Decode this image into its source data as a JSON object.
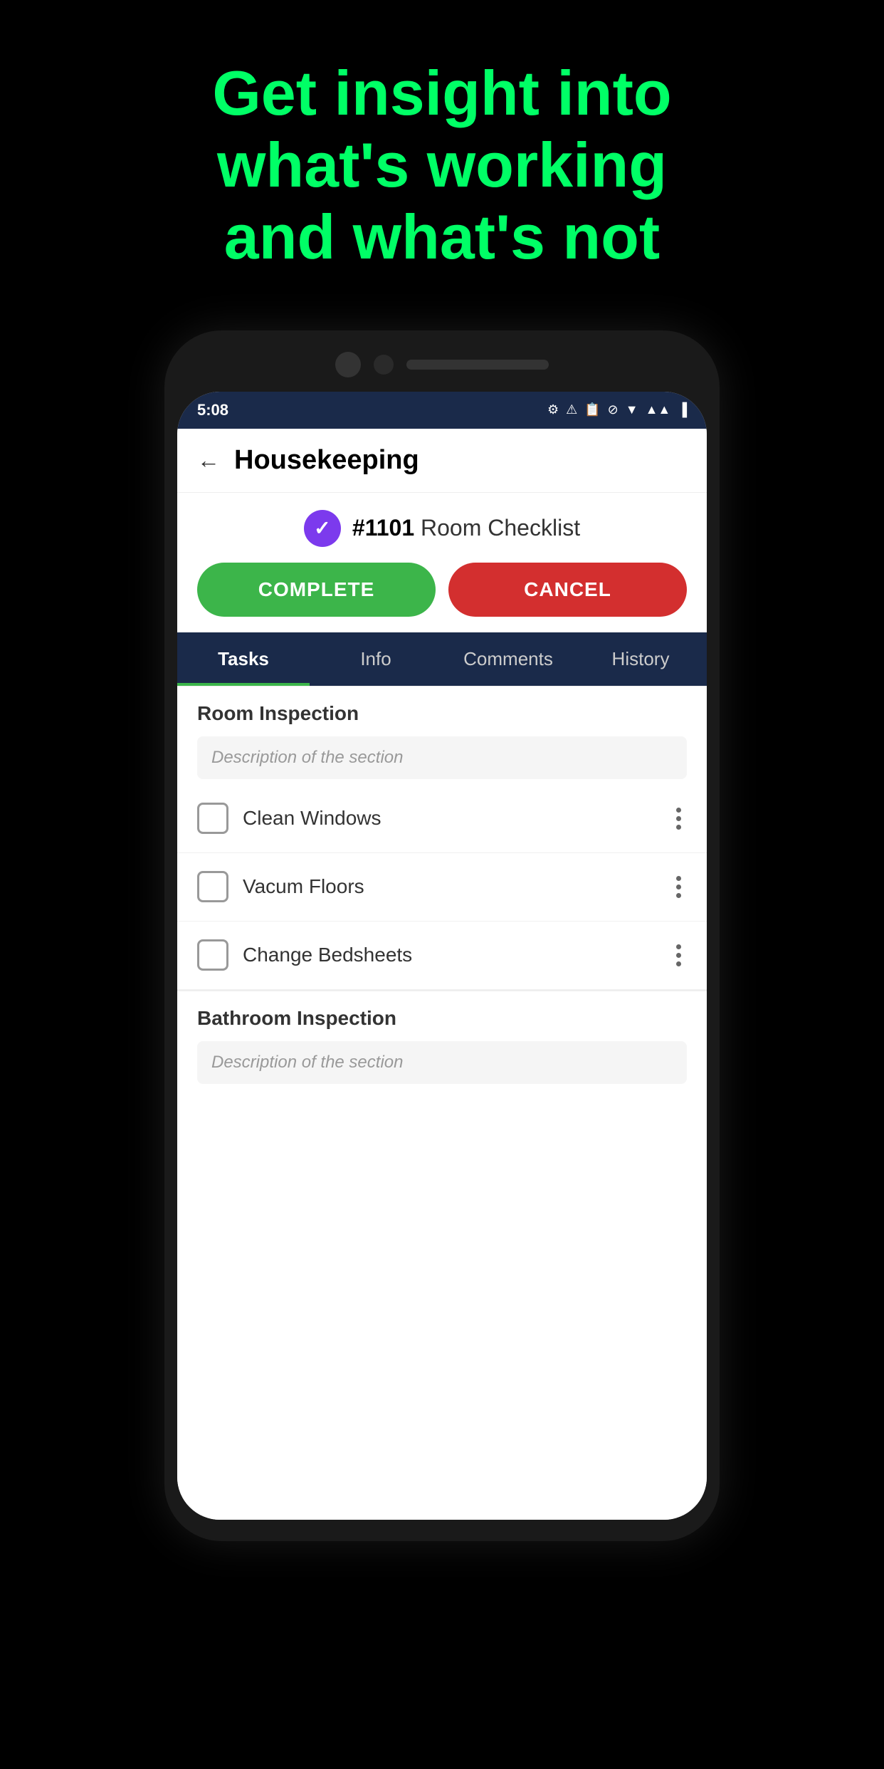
{
  "hero": {
    "line1": "Get insight into",
    "line2": "what's working",
    "line3": "and what's not"
  },
  "statusBar": {
    "time": "5:08",
    "icons": [
      "⚙",
      "⚠",
      "📋",
      "⊘",
      "▼",
      "📶",
      "🔋"
    ]
  },
  "appBar": {
    "title": "Housekeeping",
    "backLabel": "←"
  },
  "taskHeader": {
    "number": "#1101",
    "label": "Room Checklist"
  },
  "buttons": {
    "complete": "COMPLETE",
    "cancel": "CANCEL"
  },
  "tabs": [
    {
      "id": "tasks",
      "label": "Tasks",
      "active": true
    },
    {
      "id": "info",
      "label": "Info",
      "active": false
    },
    {
      "id": "comments",
      "label": "Comments",
      "active": false
    },
    {
      "id": "history",
      "label": "History",
      "active": false
    }
  ],
  "sections": [
    {
      "id": "room-inspection",
      "title": "Room Inspection",
      "description": "Description of the section",
      "items": [
        {
          "id": "clean-windows",
          "label": "Clean Windows",
          "checked": false
        },
        {
          "id": "vacum-floors",
          "label": "Vacum Floors",
          "checked": false
        },
        {
          "id": "change-bedsheets",
          "label": "Change Bedsheets",
          "checked": false
        }
      ]
    },
    {
      "id": "bathroom-inspection",
      "title": "Bathroom Inspection",
      "description": "Description of the section",
      "items": []
    }
  ]
}
